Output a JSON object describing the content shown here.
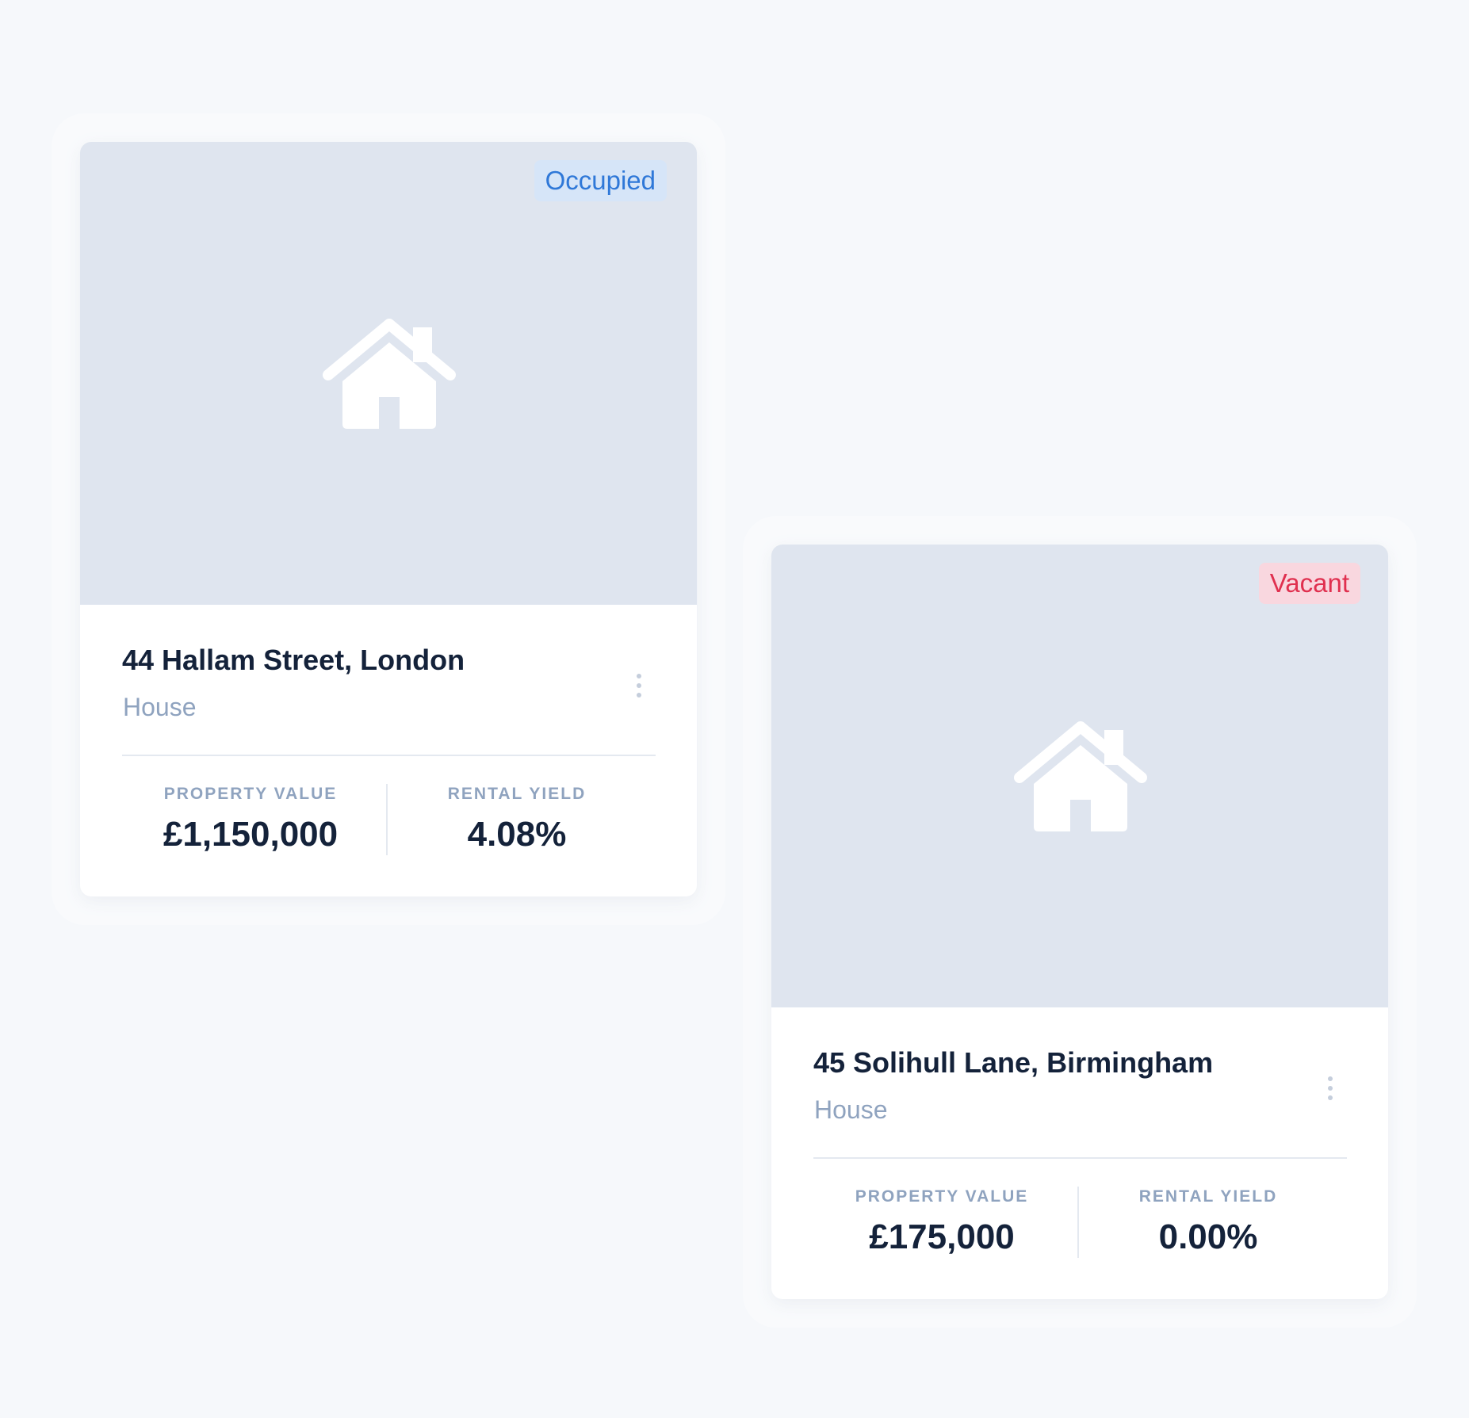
{
  "properties": [
    {
      "status": "Occupied",
      "status_color": "#2f78d8",
      "status_bg": "#d6e5f8",
      "address": "44 Hallam Street, London",
      "type": "House",
      "value_label": "PROPERTY VALUE",
      "value": "£1,150,000",
      "yield_label": "RENTAL YIELD",
      "yield": "4.08%",
      "image_icon": "house-icon",
      "menu_icon": "more-vertical-icon"
    },
    {
      "status": "Vacant",
      "status_color": "#e0304f",
      "status_bg": "#f9d7df",
      "address": "45 Solihull Lane, Birmingham",
      "type": "House",
      "value_label": "PROPERTY VALUE",
      "value": "£175,000",
      "yield_label": "RENTAL YIELD",
      "yield": "0.00%",
      "image_icon": "house-icon",
      "menu_icon": "more-vertical-icon"
    }
  ],
  "colors": {
    "background": "#f6f8fb",
    "card": "#ffffff",
    "image_placeholder": "#dfe5ef",
    "text_primary": "#14223a",
    "text_secondary": "#8fa3bf",
    "divider": "#e4e9f0"
  }
}
